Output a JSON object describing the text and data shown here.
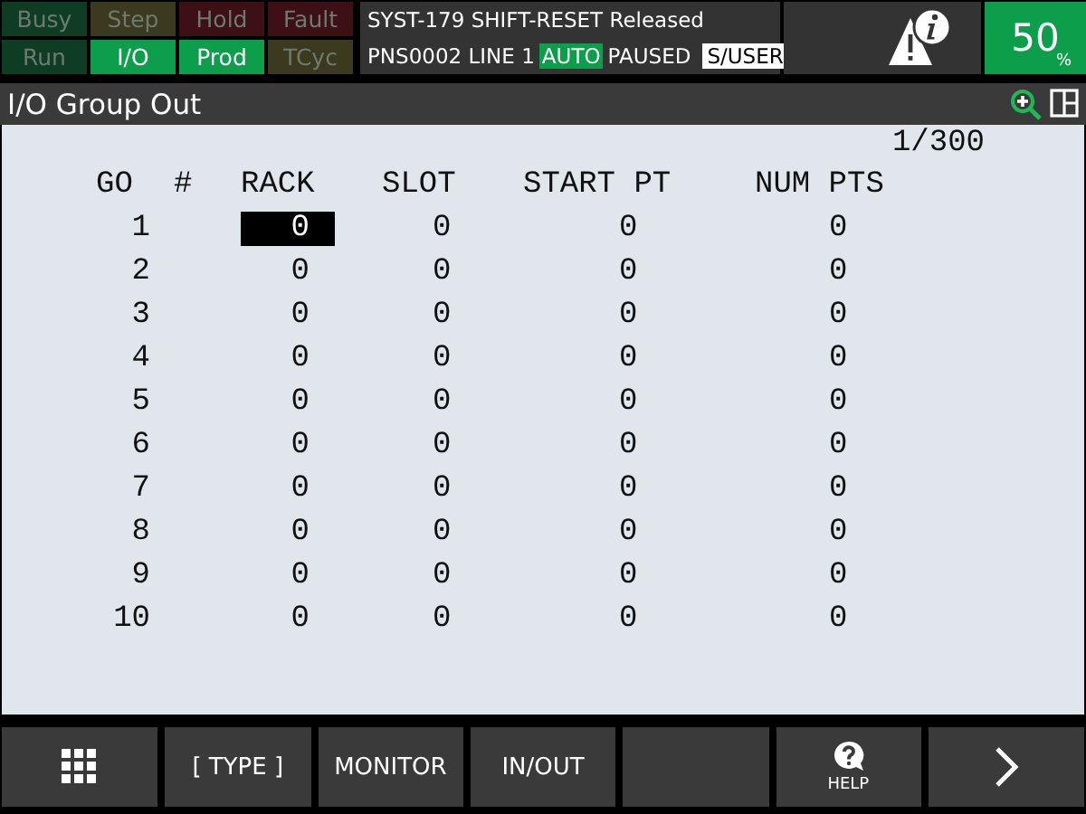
{
  "indicators": [
    {
      "label": "Busy",
      "on": false,
      "color": "#0f3d24"
    },
    {
      "label": "Step",
      "on": false,
      "color": "#3b3a1e"
    },
    {
      "label": "Hold",
      "on": false,
      "color": "#3d1016"
    },
    {
      "label": "Fault",
      "on": false,
      "color": "#3d1016"
    },
    {
      "label": "Run",
      "on": false,
      "color": "#0f3d24"
    },
    {
      "label": "I/O",
      "on": true,
      "color": "#0c9e4a"
    },
    {
      "label": "Prod",
      "on": true,
      "color": "#0c9e4a"
    },
    {
      "label": "TCyc",
      "on": false,
      "color": "#3b3a1e"
    }
  ],
  "status": {
    "alarm": "SYST-179 SHIFT-RESET Released",
    "program": "PNS0002 LINE 1",
    "mode": "AUTO",
    "state": "PAUSED",
    "user": "S/USER"
  },
  "override": {
    "value": "50",
    "unit": "%"
  },
  "window": {
    "title": "I/O Group Out"
  },
  "page": "1/300",
  "table": {
    "columns": [
      "GO",
      "#",
      "RACK",
      "SLOT",
      "START PT",
      "NUM PTS"
    ],
    "rows": [
      {
        "cells": [
          "1",
          "",
          "0",
          "0",
          "0",
          "0"
        ],
        "selected": true
      },
      {
        "cells": [
          "2",
          "",
          "0",
          "0",
          "0",
          "0"
        ],
        "selected": false
      },
      {
        "cells": [
          "3",
          "",
          "0",
          "0",
          "0",
          "0"
        ],
        "selected": false
      },
      {
        "cells": [
          "4",
          "",
          "0",
          "0",
          "0",
          "0"
        ],
        "selected": false
      },
      {
        "cells": [
          "5",
          "",
          "0",
          "0",
          "0",
          "0"
        ],
        "selected": false
      },
      {
        "cells": [
          "6",
          "",
          "0",
          "0",
          "0",
          "0"
        ],
        "selected": false
      },
      {
        "cells": [
          "7",
          "",
          "0",
          "0",
          "0",
          "0"
        ],
        "selected": false
      },
      {
        "cells": [
          "8",
          "",
          "0",
          "0",
          "0",
          "0"
        ],
        "selected": false
      },
      {
        "cells": [
          "9",
          "",
          "0",
          "0",
          "0",
          "0"
        ],
        "selected": false
      },
      {
        "cells": [
          "10",
          "",
          "0",
          "0",
          "0",
          "0"
        ],
        "selected": false
      }
    ]
  },
  "softkeys": [
    {
      "kind": "menu"
    },
    {
      "kind": "text",
      "label": "[ TYPE ]"
    },
    {
      "kind": "text",
      "label": "MONITOR"
    },
    {
      "kind": "text",
      "label": "IN/OUT"
    },
    {
      "kind": "empty"
    },
    {
      "kind": "help",
      "label": "HELP"
    },
    {
      "kind": "next"
    }
  ]
}
